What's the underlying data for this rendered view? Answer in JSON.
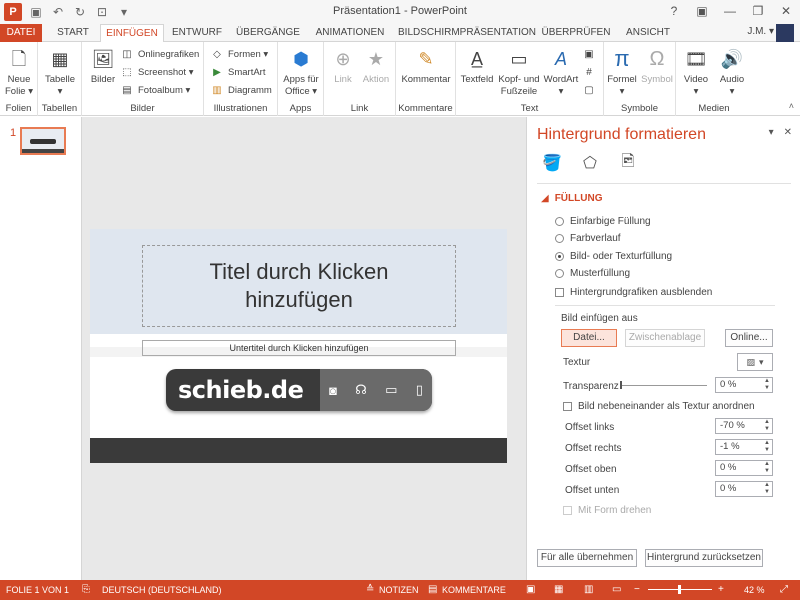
{
  "window": {
    "title": "Präsentation1 - PowerPoint",
    "user": "J.M. ▾",
    "app_letter": "P"
  },
  "tabs": [
    "DATEI",
    "START",
    "EINFÜGEN",
    "ENTWURF",
    "ÜBERGÄNGE",
    "ANIMATIONEN",
    "BILDSCHIRMPRÄSENTATION",
    "ÜBERPRÜFEN",
    "ANSICHT"
  ],
  "active_tab": "EINFÜGEN",
  "ribbon": {
    "folien": {
      "neue_folie": "Neue",
      "neue_folie2": "Folie ▾",
      "label": "Folien"
    },
    "tabellen": {
      "tabelle": "Tabelle",
      "tabelle2": "▾",
      "label": "Tabellen"
    },
    "bilder": {
      "bilder": "Bilder",
      "onlinegrafiken": "Onlinegrafiken",
      "screenshot": "Screenshot ▾",
      "fotoalbum": "Fotoalbum ▾",
      "label": "Bilder"
    },
    "illustrationen": {
      "formen": "Formen ▾",
      "smartart": "SmartArt",
      "diagramm": "Diagramm",
      "label": "Illustrationen"
    },
    "apps": {
      "apps": "Apps für",
      "apps2": "Office ▾",
      "label": "Apps"
    },
    "link": {
      "link": "Link",
      "aktion": "Aktion",
      "label": "Link"
    },
    "kommentare": {
      "kommentar": "Kommentar",
      "label": "Kommentare"
    },
    "text": {
      "textfeld": "Textfeld",
      "kopf": "Kopf- und",
      "kopf2": "Fußzeile",
      "wordart": "WordArt",
      "wordart2": "▾",
      "label": "Text"
    },
    "symbole": {
      "formel": "Formel",
      "formel2": "▾",
      "symbol": "Symbol",
      "label": "Symbole"
    },
    "medien": {
      "video": "Video",
      "video2": "▾",
      "audio": "Audio",
      "audio2": "▾",
      "label": "Medien"
    }
  },
  "slides_panel": {
    "slide_number": "1"
  },
  "slide": {
    "title_placeholder": "Titel durch Klicken hinzufügen",
    "subtitle_placeholder": "Untertitel durch Klicken hinzufügen",
    "logo_text": "schieb.de"
  },
  "pane": {
    "title": "Hintergrund formatieren",
    "section": "FÜLLUNG",
    "fill_options": [
      {
        "label": "Einfarbige Füllung",
        "selected": false
      },
      {
        "label": "Farbverlauf",
        "selected": false
      },
      {
        "label": "Bild- oder Texturfüllung",
        "selected": true
      },
      {
        "label": "Musterfüllung",
        "selected": false
      }
    ],
    "hide_graphics": "Hintergrundgrafiken ausblenden",
    "insert_from": "Bild einfügen aus",
    "btn_file": "Datei...",
    "btn_clipboard": "Zwischenablage",
    "btn_online": "Online...",
    "texture_label": "Textur",
    "transparency_label": "Transparenz",
    "transparency_value": "0 %",
    "tile_label": "Bild nebeneinander als Textur anordnen",
    "offsets": [
      {
        "label": "Offset links",
        "value": "-70 %"
      },
      {
        "label": "Offset rechts",
        "value": "-1 %"
      },
      {
        "label": "Offset oben",
        "value": "0 %"
      },
      {
        "label": "Offset unten",
        "value": "0 %"
      }
    ],
    "rotate_with_shape": "Mit Form drehen",
    "btn_apply_all": "Für alle übernehmen",
    "btn_reset": "Hintergrund zurücksetzen"
  },
  "statusbar": {
    "slide_info": "FOLIE 1 VON 1",
    "language": "DEUTSCH (DEUTSCHLAND)",
    "notes": "NOTIZEN",
    "comments": "KOMMENTARE",
    "zoom": "42 %"
  },
  "colors": {
    "accent": "#d24726",
    "ribbon_bg": "#ffffff",
    "status_bg": "#d24726"
  }
}
